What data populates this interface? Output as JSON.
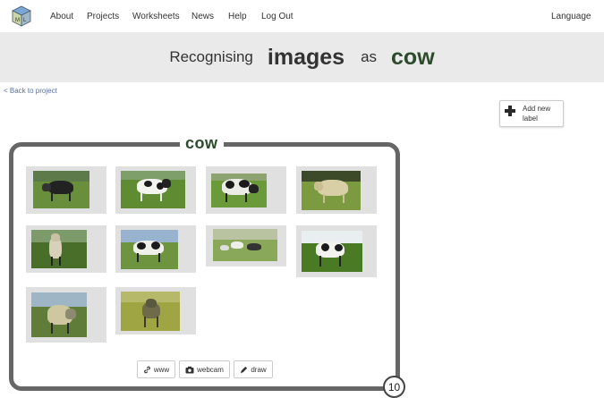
{
  "nav": {
    "logo_icon": "machine-learning-for-kids-cube-icon",
    "items": [
      "About",
      "Projects",
      "Worksheets",
      "News",
      "Help",
      "Log Out"
    ],
    "language": "Language"
  },
  "header": {
    "word1": "Recognising",
    "word2": "images",
    "word3": "as",
    "word4": "cow"
  },
  "back_link": "< Back to project",
  "add_label_button": "Add new label",
  "label": {
    "name": "cow",
    "count": "10",
    "images": [
      {
        "name": "cow-photo-1"
      },
      {
        "name": "cow-photo-2"
      },
      {
        "name": "cow-photo-3"
      },
      {
        "name": "cow-photo-4"
      },
      {
        "name": "cow-photo-5"
      },
      {
        "name": "cow-photo-6"
      },
      {
        "name": "cow-photo-7"
      },
      {
        "name": "cow-photo-8"
      },
      {
        "name": "cow-photo-9"
      },
      {
        "name": "cow-photo-10"
      }
    ],
    "sources": {
      "www": "www",
      "webcam": "webcam",
      "draw": "draw"
    }
  },
  "colors": {
    "accent_green": "#2d4a2d",
    "band": "#eaeaea",
    "box_border": "#666666"
  }
}
